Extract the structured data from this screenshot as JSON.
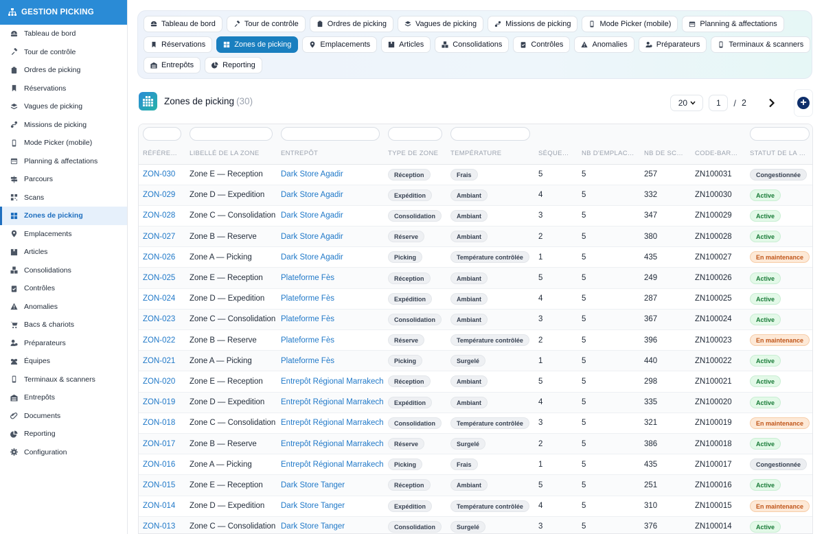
{
  "app": {
    "title": "GESTION PICKING"
  },
  "sidebar": {
    "items": [
      {
        "label": "Tableau de bord",
        "icon": "dashboard-icon",
        "active": false
      },
      {
        "label": "Tour de contrôle",
        "icon": "satellite-icon",
        "active": false
      },
      {
        "label": "Ordres de picking",
        "icon": "clipboard-icon",
        "active": false
      },
      {
        "label": "Réservations",
        "icon": "bookmark-icon",
        "active": false
      },
      {
        "label": "Vagues de picking",
        "icon": "layers-icon",
        "active": false
      },
      {
        "label": "Missions de picking",
        "icon": "route-icon",
        "active": false
      },
      {
        "label": "Mode Picker (mobile)",
        "icon": "mobile-icon",
        "active": false
      },
      {
        "label": "Planning & affectations",
        "icon": "calendar-icon",
        "active": false
      },
      {
        "label": "Parcours",
        "icon": "signpost-icon",
        "active": false
      },
      {
        "label": "Scans",
        "icon": "barcode-icon",
        "active": false
      },
      {
        "label": "Zones de picking",
        "icon": "grid-icon",
        "active": true
      },
      {
        "label": "Emplacements",
        "icon": "location-icon",
        "active": false
      },
      {
        "label": "Articles",
        "icon": "box-icon",
        "active": false
      },
      {
        "label": "Consolidations",
        "icon": "boxes-icon",
        "active": false
      },
      {
        "label": "Contrôles",
        "icon": "check-clipboard-icon",
        "active": false
      },
      {
        "label": "Anomalies",
        "icon": "warning-icon",
        "active": false
      },
      {
        "label": "Bacs & chariots",
        "icon": "cart-icon",
        "active": false
      },
      {
        "label": "Préparateurs",
        "icon": "user-gear-icon",
        "active": false
      },
      {
        "label": "Équipes",
        "icon": "users-icon",
        "active": false
      },
      {
        "label": "Terminaux & scanners",
        "icon": "mobile-icon",
        "active": false
      },
      {
        "label": "Entrepôts",
        "icon": "warehouse-icon",
        "active": false
      },
      {
        "label": "Documents",
        "icon": "paperclip-icon",
        "active": false
      },
      {
        "label": "Reporting",
        "icon": "pie-chart-icon",
        "active": false
      },
      {
        "label": "Configuration",
        "icon": "gear-icon",
        "active": false
      }
    ]
  },
  "tabs": {
    "rows": [
      [
        {
          "label": "Tableau de bord",
          "icon": "dashboard-icon"
        },
        {
          "label": "Tour de contrôle",
          "icon": "satellite-icon"
        },
        {
          "label": "Ordres de picking",
          "icon": "clipboard-icon"
        },
        {
          "label": "Vagues de picking",
          "icon": "layers-icon"
        },
        {
          "label": "Missions de picking",
          "icon": "route-icon"
        },
        {
          "label": "Mode Picker (mobile)",
          "icon": "mobile-icon"
        },
        {
          "label": "Planning & affectations",
          "icon": "calendar-icon"
        }
      ],
      [
        {
          "label": "Réservations",
          "icon": "bookmark-icon"
        },
        {
          "label": "Zones de picking",
          "icon": "grid-icon",
          "active": true
        },
        {
          "label": "Emplacements",
          "icon": "location-icon"
        },
        {
          "label": "Articles",
          "icon": "box-icon"
        },
        {
          "label": "Consolidations",
          "icon": "boxes-icon"
        },
        {
          "label": "Contrôles",
          "icon": "check-clipboard-icon"
        },
        {
          "label": "Anomalies",
          "icon": "warning-icon"
        },
        {
          "label": "Préparateurs",
          "icon": "user-gear-icon"
        },
        {
          "label": "Terminaux & scanners",
          "icon": "mobile-icon"
        }
      ],
      [
        {
          "label": "Entrepôts",
          "icon": "warehouse-icon"
        },
        {
          "label": "Reporting",
          "icon": "pie-chart-icon"
        }
      ]
    ]
  },
  "header": {
    "title": "Zones de picking",
    "count": "(30)"
  },
  "pager": {
    "page_size": "20",
    "current_page": "1",
    "separator": "/",
    "total_pages": "2"
  },
  "table": {
    "columns": [
      "Référence",
      "Libellé de la zone",
      "Entrepôt",
      "Type de zone",
      "Température",
      "Séquence",
      "Nb d'emplace...",
      "Nb de scans",
      "Code-barres",
      "Statut de la zo..."
    ],
    "rows": [
      [
        "ZON-030",
        "Zone E — Reception",
        "Dark Store Agadir",
        "Réception",
        "Frais",
        "5",
        "5",
        "257",
        "ZN100031",
        "Congestionnée"
      ],
      [
        "ZON-029",
        "Zone D — Expedition",
        "Dark Store Agadir",
        "Expédition",
        "Ambiant",
        "4",
        "5",
        "332",
        "ZN100030",
        "Active"
      ],
      [
        "ZON-028",
        "Zone C — Consolidation",
        "Dark Store Agadir",
        "Consolidation",
        "Ambiant",
        "3",
        "5",
        "347",
        "ZN100029",
        "Active"
      ],
      [
        "ZON-027",
        "Zone B — Reserve",
        "Dark Store Agadir",
        "Réserve",
        "Ambiant",
        "2",
        "5",
        "380",
        "ZN100028",
        "Active"
      ],
      [
        "ZON-026",
        "Zone A — Picking",
        "Dark Store Agadir",
        "Picking",
        "Température contrôlée",
        "1",
        "5",
        "435",
        "ZN100027",
        "En maintenance"
      ],
      [
        "ZON-025",
        "Zone E — Reception",
        "Plateforme Fès",
        "Réception",
        "Ambiant",
        "5",
        "5",
        "249",
        "ZN100026",
        "Active"
      ],
      [
        "ZON-024",
        "Zone D — Expedition",
        "Plateforme Fès",
        "Expédition",
        "Ambiant",
        "4",
        "5",
        "287",
        "ZN100025",
        "Active"
      ],
      [
        "ZON-023",
        "Zone C — Consolidation",
        "Plateforme Fès",
        "Consolidation",
        "Ambiant",
        "3",
        "5",
        "367",
        "ZN100024",
        "Active"
      ],
      [
        "ZON-022",
        "Zone B — Reserve",
        "Plateforme Fès",
        "Réserve",
        "Température contrôlée",
        "2",
        "5",
        "396",
        "ZN100023",
        "En maintenance"
      ],
      [
        "ZON-021",
        "Zone A — Picking",
        "Plateforme Fès",
        "Picking",
        "Surgelé",
        "1",
        "5",
        "440",
        "ZN100022",
        "Active"
      ],
      [
        "ZON-020",
        "Zone E — Reception",
        "Entrepôt Régional Marrakech",
        "Réception",
        "Ambiant",
        "5",
        "5",
        "298",
        "ZN100021",
        "Active"
      ],
      [
        "ZON-019",
        "Zone D — Expedition",
        "Entrepôt Régional Marrakech",
        "Expédition",
        "Ambiant",
        "4",
        "5",
        "335",
        "ZN100020",
        "Active"
      ],
      [
        "ZON-018",
        "Zone C — Consolidation",
        "Entrepôt Régional Marrakech",
        "Consolidation",
        "Température contrôlée",
        "3",
        "5",
        "321",
        "ZN100019",
        "En maintenance"
      ],
      [
        "ZON-017",
        "Zone B — Reserve",
        "Entrepôt Régional Marrakech",
        "Réserve",
        "Surgelé",
        "2",
        "5",
        "386",
        "ZN100018",
        "Active"
      ],
      [
        "ZON-016",
        "Zone A — Picking",
        "Entrepôt Régional Marrakech",
        "Picking",
        "Frais",
        "1",
        "5",
        "435",
        "ZN100017",
        "Congestionnée"
      ],
      [
        "ZON-015",
        "Zone E — Reception",
        "Dark Store Tanger",
        "Réception",
        "Ambiant",
        "5",
        "5",
        "251",
        "ZN100016",
        "Active"
      ],
      [
        "ZON-014",
        "Zone D — Expedition",
        "Dark Store Tanger",
        "Expédition",
        "Température contrôlée",
        "4",
        "5",
        "310",
        "ZN100015",
        "En maintenance"
      ],
      [
        "ZON-013",
        "Zone C — Consolidation",
        "Dark Store Tanger",
        "Consolidation",
        "Surgelé",
        "3",
        "5",
        "376",
        "ZN100014",
        "Active"
      ]
    ]
  },
  "colors": {
    "brand": "#2a8bd6",
    "active_tab": "#1a7fbf",
    "link": "#1f78c8"
  }
}
